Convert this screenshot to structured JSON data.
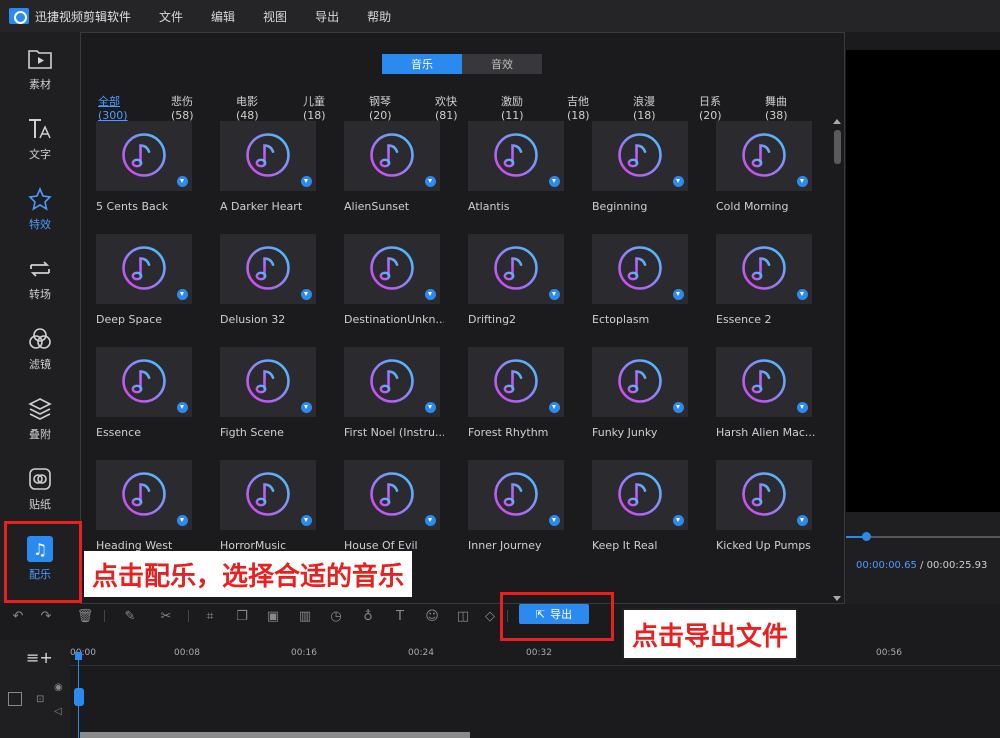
{
  "app": {
    "title": "迅捷视频剪辑软件"
  },
  "menu": [
    "文件",
    "编辑",
    "视图",
    "导出",
    "帮助"
  ],
  "sidebar": {
    "items": [
      {
        "label": "素材",
        "icon": "folder-play-icon"
      },
      {
        "label": "文字",
        "icon": "text-icon"
      },
      {
        "label": "特效",
        "icon": "star-effect-icon"
      },
      {
        "label": "转场",
        "icon": "transition-icon"
      },
      {
        "label": "滤镜",
        "icon": "filter-icon"
      },
      {
        "label": "叠附",
        "icon": "layers-icon"
      },
      {
        "label": "贴纸",
        "icon": "sticker-icon"
      },
      {
        "label": "配乐",
        "icon": "music-icon"
      }
    ]
  },
  "panel": {
    "tabs": [
      {
        "label": "音乐",
        "active": true
      },
      {
        "label": "音效",
        "active": false
      }
    ],
    "categories": [
      "全部(300)",
      "悲伤(58)",
      "电影(48)",
      "儿童(18)",
      "钢琴(20)",
      "欢快(81)",
      "激励(11)",
      "吉他(18)",
      "浪漫(18)",
      "日系(20)",
      "舞曲(38)"
    ],
    "tracks": [
      "5 Cents Back",
      "A Darker Heart",
      "AlienSunset",
      "Atlantis",
      "Beginning",
      "Cold Morning",
      "Deep Space",
      "Delusion 32",
      "DestinationUnkn...",
      "Drifting2",
      "Ectoplasm",
      "Essence 2",
      "Essence",
      "Figth Scene",
      "First Noel (Instru...",
      "Forest Rhythm",
      "Funky Junky",
      "Harsh Alien Mac...",
      "Heading West",
      "HorrorMusic",
      "House Of Evil",
      "Inner Journey",
      "Keep It Real",
      "Kicked Up Pumps"
    ]
  },
  "preview": {
    "current": "00:00:00.65",
    "separator": "/",
    "total": "00:00:25.93"
  },
  "toolbar": {
    "export_label": "导出"
  },
  "timeline": {
    "ticks": [
      "00:00",
      "00:08",
      "00:16",
      "00:24",
      "00:32",
      "00:56"
    ]
  },
  "callouts": {
    "music": "点击配乐，选择合适的音乐",
    "export": "点击导出文件"
  },
  "colors": {
    "accent": "#2a8af0",
    "callout": "#e8201f"
  }
}
